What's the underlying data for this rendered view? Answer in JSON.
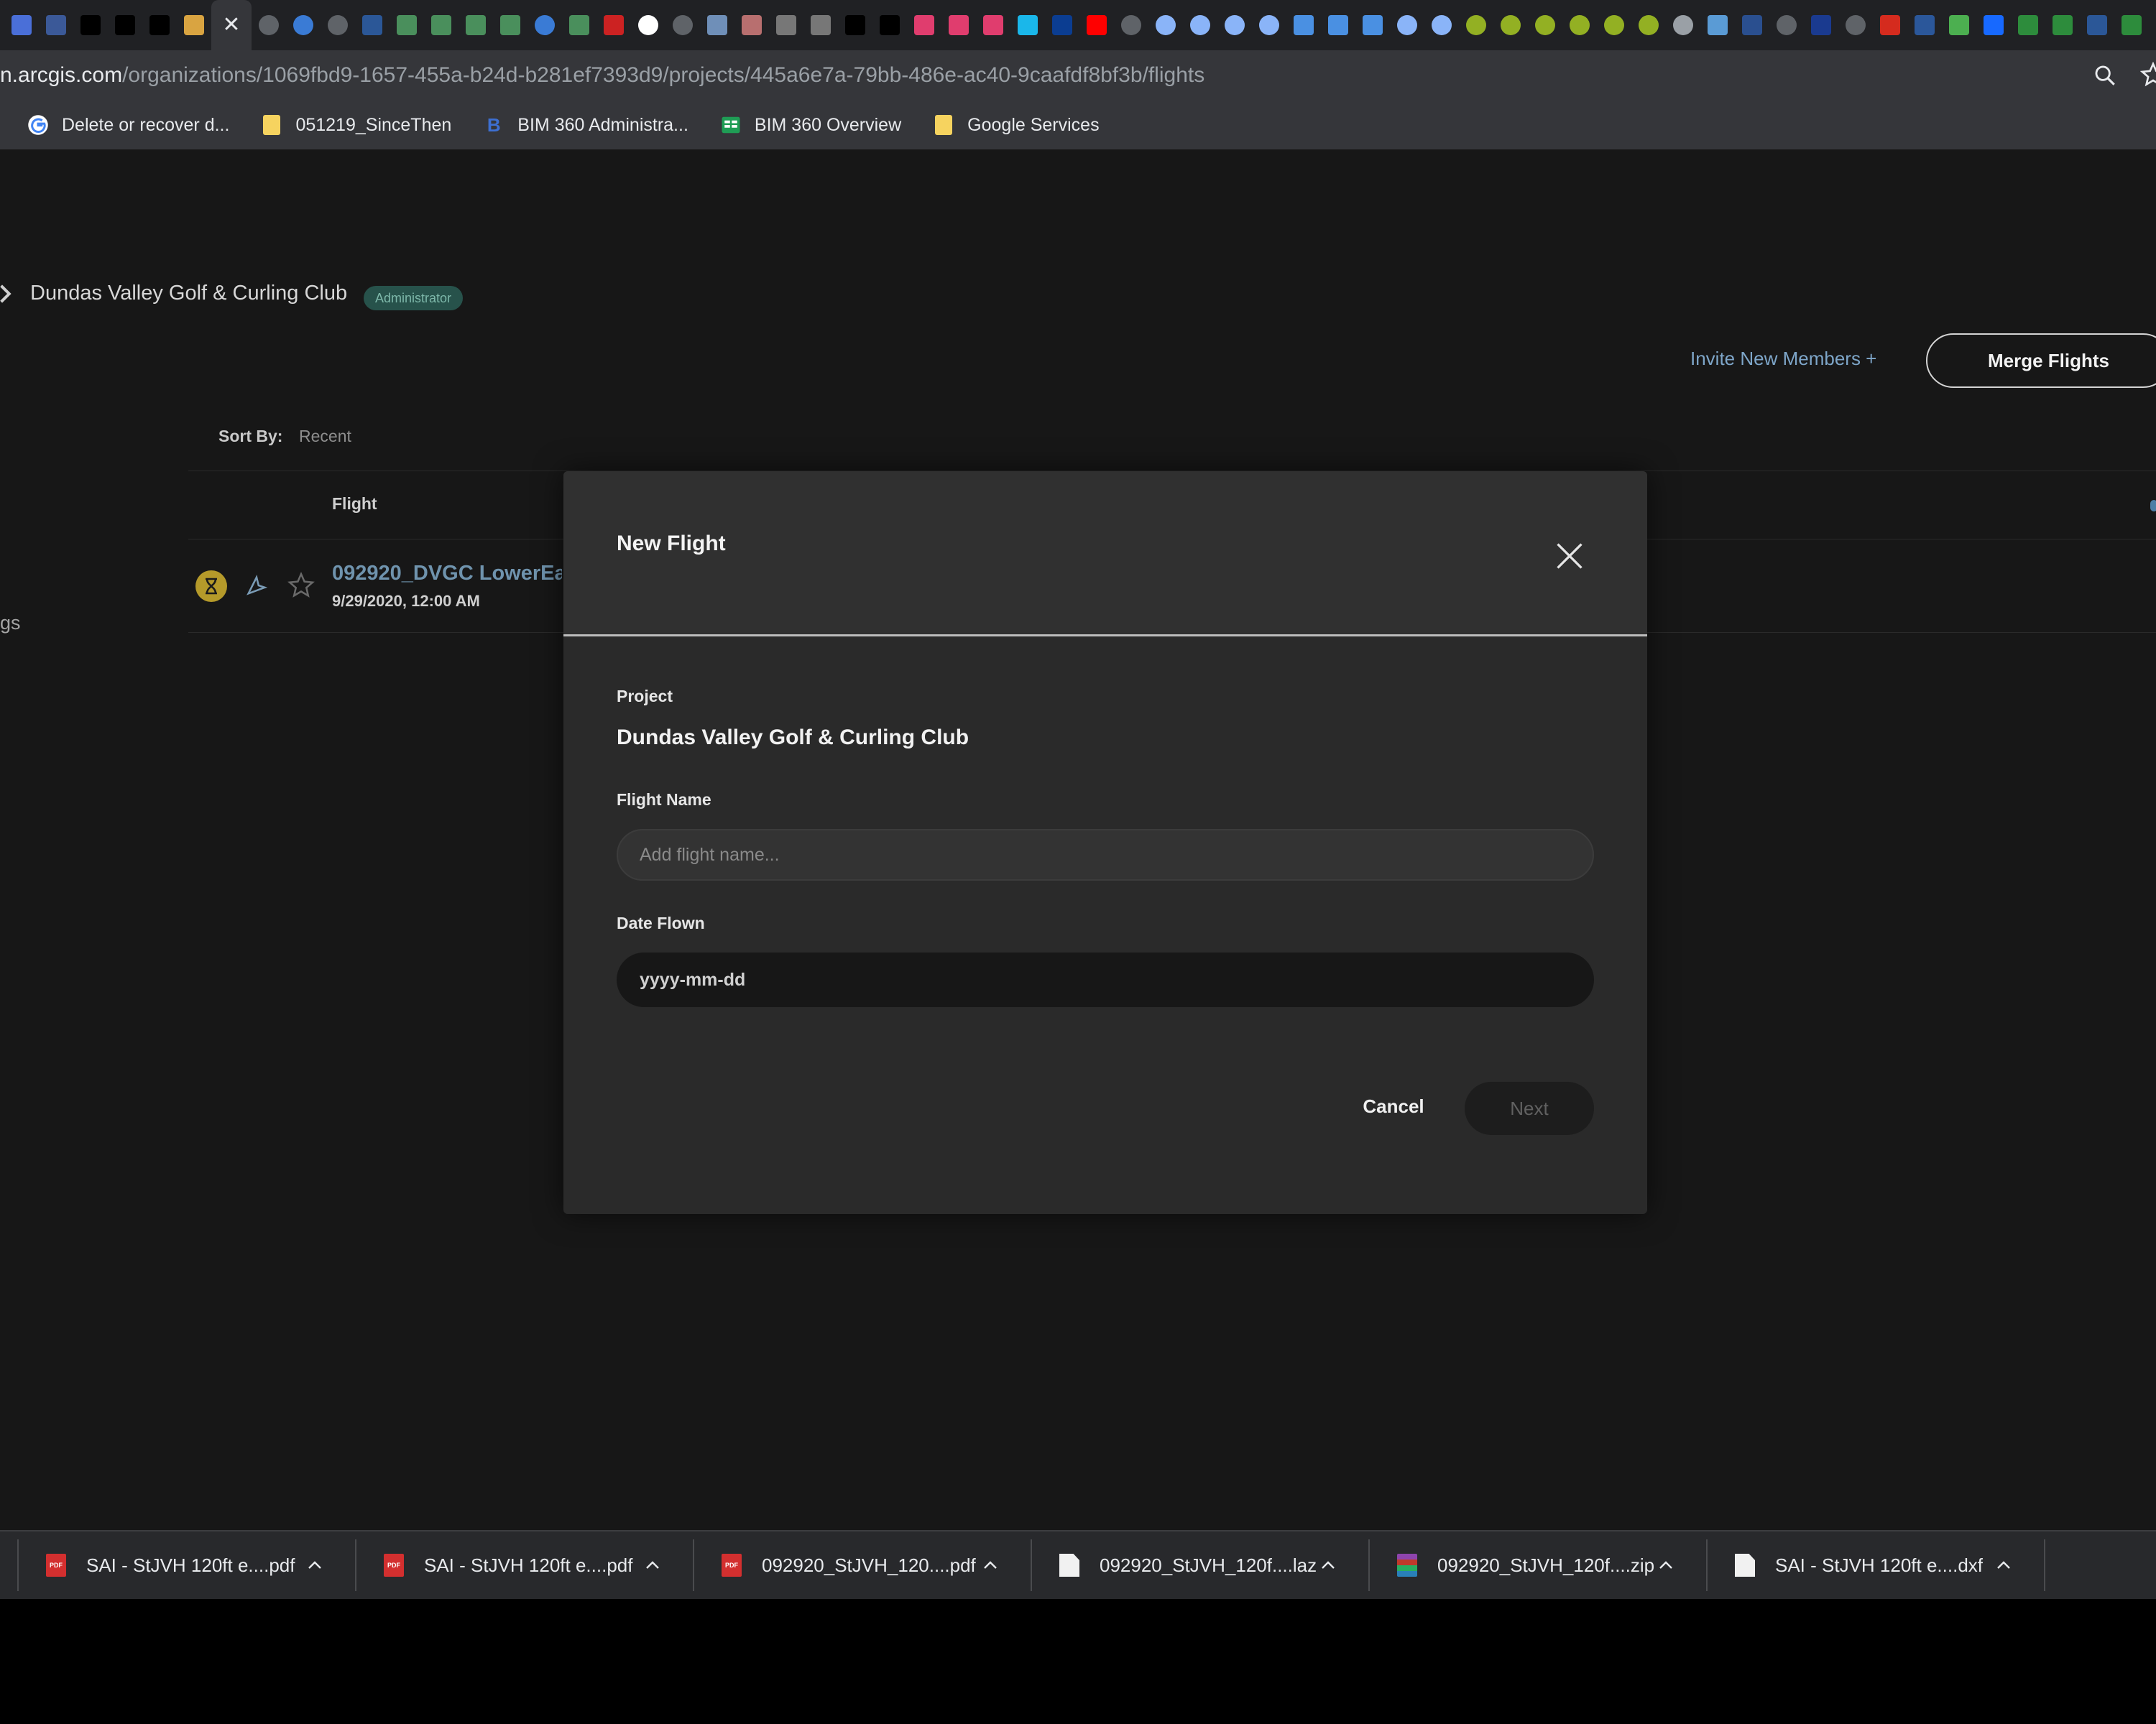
{
  "browser": {
    "tab_favicons": [
      {
        "icon": "s-letter-icon",
        "color": "#4a6fd8"
      },
      {
        "icon": "facebook-icon",
        "color": "#3b5998"
      },
      {
        "icon": "pill-icon",
        "color": "#000000"
      },
      {
        "icon": "pill-icon",
        "color": "#000000"
      },
      {
        "icon": "pill-icon",
        "color": "#000000"
      },
      {
        "icon": "layers-icon",
        "color": "#d9a441"
      },
      {
        "icon": "globe-icon",
        "color": "#5f6368"
      },
      {
        "icon": "earth-icon",
        "color": "#3a7bd5"
      },
      {
        "icon": "globe-icon",
        "color": "#5f6368"
      },
      {
        "icon": "b-letter-icon",
        "color": "#2b5797"
      },
      {
        "icon": "map-icon",
        "color": "#4a8f5c"
      },
      {
        "icon": "map-icon",
        "color": "#4a8f5c"
      },
      {
        "icon": "map-icon",
        "color": "#4a8f5c"
      },
      {
        "icon": "map-icon",
        "color": "#4a8f5c"
      },
      {
        "icon": "earth-icon",
        "color": "#3a7bd5"
      },
      {
        "icon": "map-icon",
        "color": "#4a8f5c"
      },
      {
        "icon": "n-letter-icon",
        "color": "#cc2222"
      },
      {
        "icon": "google-icon",
        "color": "#ffffff"
      },
      {
        "icon": "globe-icon",
        "color": "#5f6368"
      },
      {
        "icon": "browser-icon",
        "color": "#6f8fb8"
      },
      {
        "icon": "browser-icon",
        "color": "#b86f6f"
      },
      {
        "icon": "gear-icon",
        "color": "#777777"
      },
      {
        "icon": "gear-icon",
        "color": "#777777"
      },
      {
        "icon": "diamond-icon",
        "color": "#000000"
      },
      {
        "icon": "diamond-icon",
        "color": "#000000"
      },
      {
        "icon": "lib-icon",
        "color": "#e03d6e"
      },
      {
        "icon": "lib-icon",
        "color": "#e03d6e"
      },
      {
        "icon": "lib-icon",
        "color": "#e03d6e"
      },
      {
        "icon": "v-letter-icon",
        "color": "#1ab7ea"
      },
      {
        "icon": "nasa-icon",
        "color": "#0b3d91"
      },
      {
        "icon": "youtube-icon",
        "color": "#ff0000"
      },
      {
        "icon": "globe-icon",
        "color": "#5f6368"
      },
      {
        "icon": "filter-icon",
        "color": "#8ab4f8"
      },
      {
        "icon": "filter-icon",
        "color": "#8ab4f8"
      },
      {
        "icon": "filter-icon",
        "color": "#8ab4f8"
      },
      {
        "icon": "filter-icon",
        "color": "#8ab4f8"
      },
      {
        "icon": "book-icon",
        "color": "#4a90e2"
      },
      {
        "icon": "book-icon",
        "color": "#4a90e2"
      },
      {
        "icon": "book-icon",
        "color": "#4a90e2"
      },
      {
        "icon": "filter-icon",
        "color": "#8ab4f8"
      },
      {
        "icon": "filter-icon",
        "color": "#8ab4f8"
      },
      {
        "icon": "qgis-icon",
        "color": "#93b023"
      },
      {
        "icon": "qgis-icon",
        "color": "#93b023"
      },
      {
        "icon": "qgis-icon",
        "color": "#93b023"
      },
      {
        "icon": "qgis-icon",
        "color": "#93b023"
      },
      {
        "icon": "qgis-icon",
        "color": "#93b023"
      },
      {
        "icon": "qgis-icon",
        "color": "#93b023"
      },
      {
        "icon": "globe-icon",
        "color": "#9aa0a6"
      },
      {
        "icon": "map-icon",
        "color": "#5a9bd5"
      },
      {
        "icon": "n-letter-icon",
        "color": "#2a4f8f"
      },
      {
        "icon": "globe-icon",
        "color": "#5f6368"
      },
      {
        "icon": "plane-icon",
        "color": "#1a3a8f"
      },
      {
        "icon": "globe-icon",
        "color": "#5f6368"
      },
      {
        "icon": "maple-leaf-icon",
        "color": "#d52b1e"
      },
      {
        "icon": "w-letter-icon",
        "color": "#2b579a"
      },
      {
        "icon": "chevrons-icon",
        "color": "#4caf50"
      },
      {
        "icon": "behance-icon",
        "color": "#1769ff"
      },
      {
        "icon": "a-letter-icon",
        "color": "#2d8c3c"
      },
      {
        "icon": "a-letter-icon",
        "color": "#2d8c3c"
      },
      {
        "icon": "b-letter-icon",
        "color": "#2b5797"
      },
      {
        "icon": "a-letter-icon",
        "color": "#2d8c3c"
      },
      {
        "icon": "a-letter-icon",
        "color": "#2d8c3c"
      },
      {
        "icon": "globe-icon",
        "color": "#5f6368"
      },
      {
        "icon": "a-letter-icon",
        "color": "#444444"
      }
    ],
    "url_host": "n.arcgis.com",
    "url_path": "/organizations/1069fbd9-1657-455a-b24d-b281ef7393d9/projects/445a6e7a-79bb-486e-ac40-9caafdf8bf3b/flights",
    "bookmarks": [
      {
        "icon": "google-icon",
        "label": "Delete or recover d..."
      },
      {
        "icon": "folder-icon",
        "label": "051219_SinceThen"
      },
      {
        "icon": "b-letter-icon",
        "label": "BIM 360 Administra..."
      },
      {
        "icon": "spreadsheet-icon",
        "label": "BIM 360 Overview"
      },
      {
        "icon": "folder-icon",
        "label": "Google Services"
      }
    ]
  },
  "page": {
    "project_title": "Dundas Valley Golf & Curling Club",
    "role_badge": "Administrator",
    "invite_link": "Invite New Members +",
    "merge_button": "Merge Flights",
    "sort_label": "Sort By:",
    "sort_value": "Recent",
    "column_flight": "Flight",
    "row": {
      "name": "092920_DVGC LowerEa",
      "date": "9/29/2020, 12:00 AM"
    },
    "side_fragment": "gs"
  },
  "modal": {
    "title": "New Flight",
    "project_label": "Project",
    "project_value": "Dundas Valley Golf & Curling Club",
    "flight_name_label": "Flight Name",
    "flight_name_placeholder": "Add flight name...",
    "flight_name_value": "",
    "date_label": "Date Flown",
    "date_placeholder": "yyyy-mm-dd",
    "cancel_label": "Cancel",
    "next_label": "Next"
  },
  "downloads": [
    {
      "type": "pdf",
      "name": "SAI - StJVH 120ft e....pdf"
    },
    {
      "type": "pdf",
      "name": "SAI - StJVH 120ft e....pdf"
    },
    {
      "type": "pdf",
      "name": "092920_StJVH_120....pdf"
    },
    {
      "type": "file",
      "name": "092920_StJVH_120f....laz"
    },
    {
      "type": "zip",
      "name": "092920_StJVH_120f....zip"
    },
    {
      "type": "file",
      "name": "SAI - StJVH 120ft e....dxf"
    }
  ],
  "colors": {
    "accent_teal": "#27524b",
    "link_blue": "#7ea6c9",
    "status_gold": "#b59a2a"
  }
}
